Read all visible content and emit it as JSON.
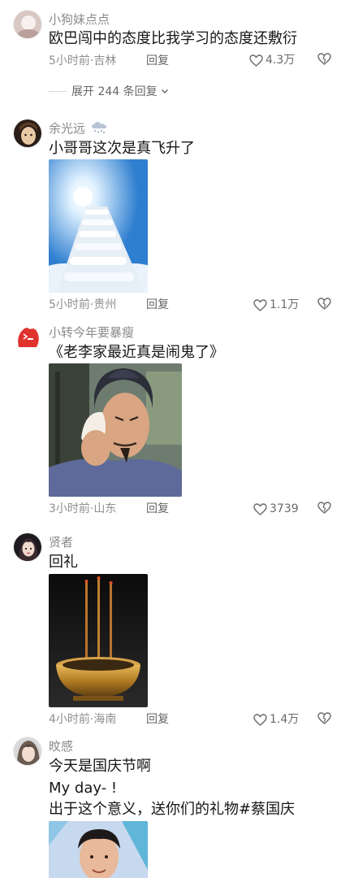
{
  "comments": [
    {
      "username": "小狗妹点点",
      "text": "欧巴闯中的态度比我学习的态度还敷衍",
      "time_location": "5小时前·吉林",
      "reply_label": "回复",
      "likes": "4.3万",
      "expand_label": "展开 244 条回复"
    },
    {
      "username": "余光远",
      "text": "小哥哥这次是真飞升了",
      "time_location": "5小时前·贵州",
      "reply_label": "回复",
      "likes": "1.1万"
    },
    {
      "username": "小转今年要暴瘦",
      "text": "《老李家最近真是闹鬼了》",
      "time_location": "3小时前·山东",
      "reply_label": "回复",
      "likes": "3739"
    },
    {
      "username": "贤者",
      "text": "回礼",
      "time_location": "4小时前·海南",
      "reply_label": "回复",
      "likes": "1.4万"
    },
    {
      "username": "旼感",
      "text_lines": [
        "今天是国庆节啊",
        "My day- !",
        "出于这个意义，送你们的礼物#蔡国庆"
      ]
    }
  ],
  "icons": {
    "like": "heart-outline-icon",
    "dislike": "broken-heart-icon",
    "expand": "chevron-down-icon",
    "weather_badge": "snow-cloud-icon"
  },
  "colors": {
    "background": "#ffffff",
    "primary_text": "#161616",
    "secondary_text": "#8a8a8a",
    "meta_text": "#8f8f8f"
  }
}
